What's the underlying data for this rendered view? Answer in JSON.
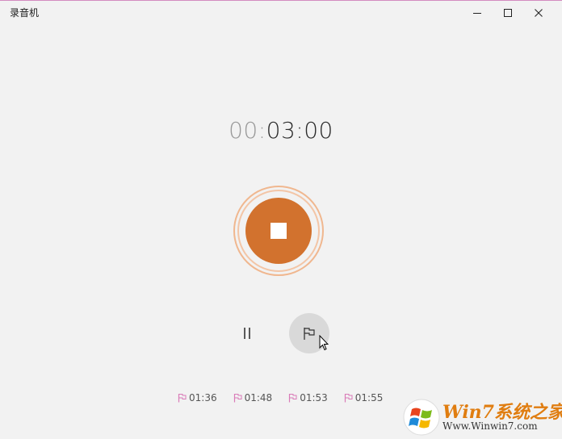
{
  "window": {
    "title": "录音机"
  },
  "timer": {
    "dim_part": "00:",
    "bright_part": "03:00"
  },
  "controls": {
    "stop_icon": "stop-square-icon",
    "pause_icon": "pause-icon",
    "flag_icon": "flag-icon"
  },
  "markers": [
    {
      "time": "01:36"
    },
    {
      "time": "01:48"
    },
    {
      "time": "01:53"
    },
    {
      "time": "01:55"
    }
  ],
  "colors": {
    "accent": "#d2722e",
    "ring": "#f0b78f",
    "marker_flag": "#d97bb8"
  },
  "watermark": {
    "brand": "Win7系统之家",
    "url": "Www.Winwin7.com"
  }
}
